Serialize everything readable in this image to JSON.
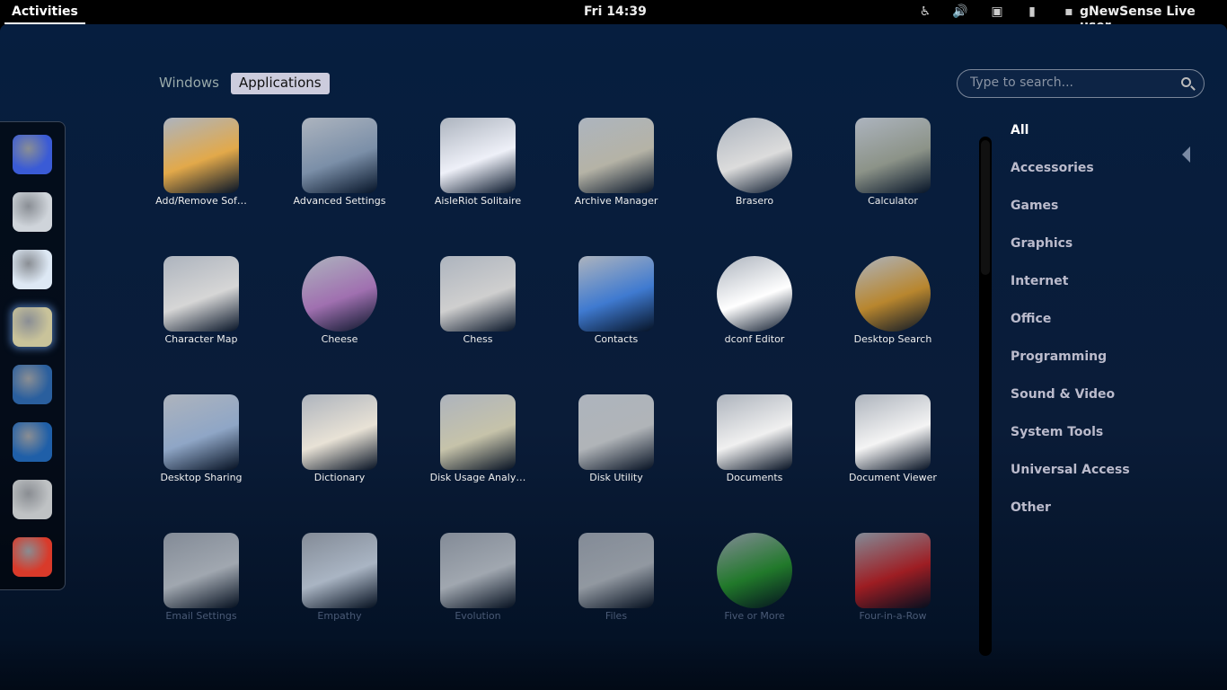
{
  "topbar": {
    "activities": "Activities",
    "clock": "Fri 14:39",
    "user": "gNewSense Live user",
    "tray_icons": [
      "accessibility-icon",
      "volume-icon",
      "network-disconnected-icon",
      "battery-icon",
      "chat-status-icon"
    ]
  },
  "dash": {
    "items": [
      {
        "name": "web-browser-icon",
        "color": "#3a5bd6"
      },
      {
        "name": "evolution-mail-icon",
        "color": "#cfd4da"
      },
      {
        "name": "empathy-chat-icon",
        "color": "#dde8f4"
      },
      {
        "name": "rhythmbox-speaker-icon",
        "color": "#c9c39a"
      },
      {
        "name": "image-viewer-icon",
        "color": "#2a5f9e"
      },
      {
        "name": "libreoffice-writer-icon",
        "color": "#1f5fa8"
      },
      {
        "name": "file-cabinet-icon",
        "color": "#bfc2c4"
      },
      {
        "name": "help-lifebuoy-icon",
        "color": "#d93a2a"
      }
    ]
  },
  "tabs": {
    "windows": "Windows",
    "applications": "Applications"
  },
  "search": {
    "placeholder": "Type to search..."
  },
  "apps": [
    {
      "label": "Add/Remove Sof…",
      "icon": "packages-icon",
      "color": "#e2a94a"
    },
    {
      "label": "Advanced Settings",
      "icon": "tools-icon",
      "color": "#7b8fa8"
    },
    {
      "label": "AisleRiot Solitaire",
      "icon": "cards-icon",
      "color": "#eef0f8"
    },
    {
      "label": "Archive Manager",
      "icon": "archive-roller-icon",
      "color": "#b5b3a6"
    },
    {
      "label": "Brasero",
      "icon": "disc-icon",
      "color": "#dcdcdc"
    },
    {
      "label": "Calculator",
      "icon": "calculator-icon",
      "color": "#8c9388"
    },
    {
      "label": "Character Map",
      "icon": "keycap-icon",
      "color": "#d6d6d6"
    },
    {
      "label": "Cheese",
      "icon": "webcam-icon",
      "color": "#a070b0"
    },
    {
      "label": "Chess",
      "icon": "chess-icon",
      "color": "#cfcfcf"
    },
    {
      "label": "Contacts",
      "icon": "address-book-icon",
      "color": "#3f7ad0"
    },
    {
      "label": "dconf Editor",
      "icon": "dconf-magnifier-icon",
      "color": "#ffffff"
    },
    {
      "label": "Desktop Search",
      "icon": "magnifier-icon",
      "color": "#b8862e"
    },
    {
      "label": "Desktop Sharing",
      "icon": "monitor-icon",
      "color": "#8fa6c6"
    },
    {
      "label": "Dictionary",
      "icon": "book-icon",
      "color": "#e8e2d6"
    },
    {
      "label": "Disk Usage Analy…",
      "icon": "folder-pie-icon",
      "color": "#c6c3aa"
    },
    {
      "label": "Disk Utility",
      "icon": "harddisk-icon",
      "color": "#b0b4b8"
    },
    {
      "label": "Documents",
      "icon": "documents-icon",
      "color": "#f0f0f0"
    },
    {
      "label": "Document Viewer",
      "icon": "evince-icon",
      "color": "#f4f4f4"
    },
    {
      "label": "Email Settings",
      "icon": "mail-clock-icon",
      "color": "#d4d8dc"
    },
    {
      "label": "Empathy",
      "icon": "chat-bubble-icon",
      "color": "#e0eaf6"
    },
    {
      "label": "Evolution",
      "icon": "mail-clock-icon",
      "color": "#d4d8dc"
    },
    {
      "label": "Files",
      "icon": "file-cabinet-icon",
      "color": "#c0c4c8"
    },
    {
      "label": "Five or More",
      "icon": "balls-icon",
      "color": "#2a9a2a"
    },
    {
      "label": "Four-in-a-Row",
      "icon": "four-in-row-icon",
      "color": "#d02020"
    }
  ],
  "categories": [
    "All",
    "Accessories",
    "Games",
    "Graphics",
    "Internet",
    "Office",
    "Programming",
    "Sound & Video",
    "System Tools",
    "Universal Access",
    "Other"
  ],
  "selected_category": "All"
}
